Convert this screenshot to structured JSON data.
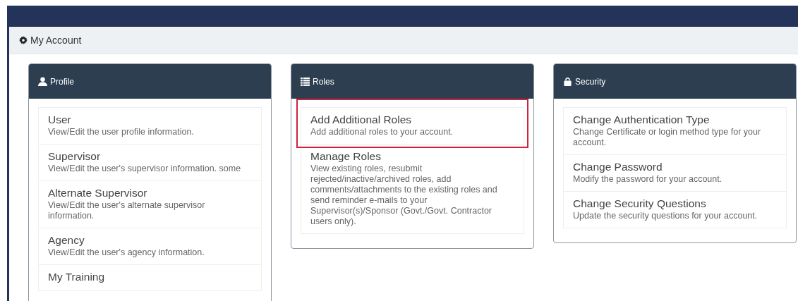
{
  "page_header": {
    "title": "My Account"
  },
  "panels": [
    {
      "title": "Profile",
      "items": [
        {
          "title": "User",
          "description": "View/Edit the user profile information.",
          "highlighted": false
        },
        {
          "title": "Supervisor",
          "description": "View/Edit the user's supervisor information. some",
          "highlighted": false
        },
        {
          "title": "Alternate Supervisor",
          "description": "View/Edit the user's alternate supervisor information.",
          "highlighted": false
        },
        {
          "title": "Agency",
          "description": "View/Edit the user's agency information.",
          "highlighted": false
        },
        {
          "title": "My Training",
          "highlighted": false
        }
      ]
    },
    {
      "title": "Roles",
      "items": [
        {
          "title": "Add Additional Roles",
          "description": "Add additional roles to your account.",
          "highlighted": true
        },
        {
          "title": "Manage Roles",
          "description": "View existing roles, resubmit rejected/inactive/archived roles, add comments/attachments to the existing roles and send reminder e-mails to your Supervisor(s)/Sponsor (Govt./Govt. Contractor users only).",
          "highlighted": false
        }
      ]
    },
    {
      "title": "Security",
      "items": [
        {
          "title": "Change Authentication Type",
          "description": "Change Certificate or login method type for your account.",
          "highlighted": false
        },
        {
          "title": "Change Password",
          "description": "Modify the password for your account.",
          "highlighted": false
        },
        {
          "title": "Change Security Questions",
          "description": "Update the security questions for your account.",
          "highlighted": false
        }
      ]
    }
  ]
}
